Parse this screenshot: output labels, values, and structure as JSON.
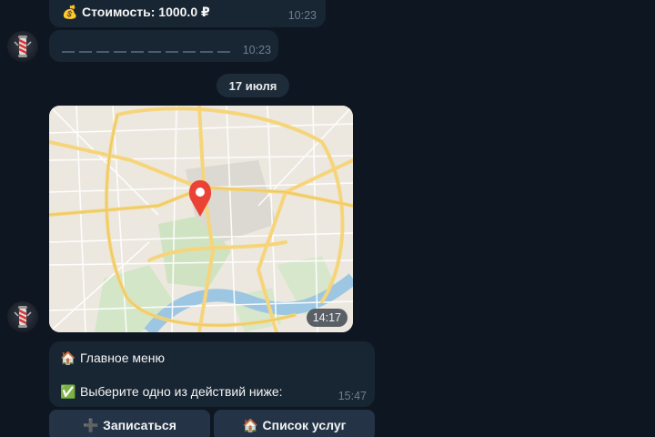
{
  "messages": {
    "cost": {
      "icon": "money-bag-icon",
      "emoji": "💰",
      "text": "Стоимость: 1000.0 ₽",
      "time": "10:23"
    },
    "dashes": {
      "time": "10:23"
    },
    "date_separator": "17 июля",
    "location": {
      "time": "14:17"
    },
    "menu": {
      "title_icon": "house-icon",
      "title_emoji": "🏠",
      "title": "Главное меню",
      "prompt_icon": "check-mark-icon",
      "prompt_emoji": "✅",
      "prompt": "Выберите одно из действий ниже:",
      "time": "15:47"
    }
  },
  "keyboard": {
    "buttons": [
      {
        "emoji": "➕",
        "icon": "plus-icon",
        "label": "Записаться"
      },
      {
        "emoji": "🏠",
        "icon": "house-icon",
        "label": "Список услуг"
      }
    ]
  },
  "colors": {
    "background": "#0e1621",
    "bubble": "#182533",
    "keyboard_button": "#243446",
    "map_pin": "#ea4335"
  }
}
